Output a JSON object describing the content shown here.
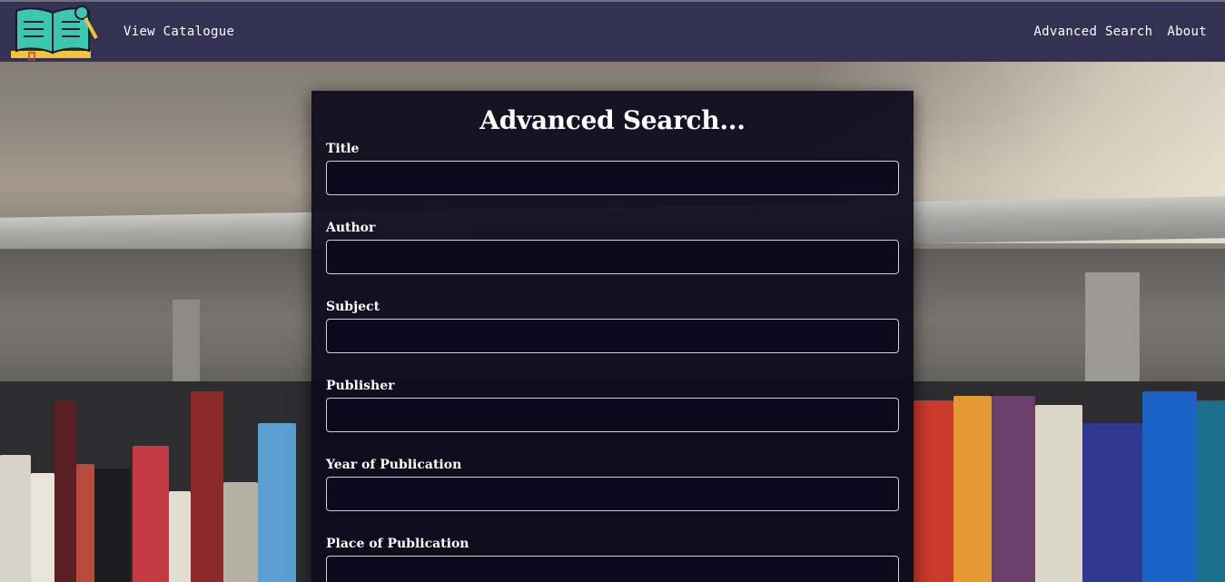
{
  "nav": {
    "logo_icon": "book-magnifier-logo",
    "view_catalogue": "View Catalogue",
    "advanced_search": "Advanced Search",
    "about": "About"
  },
  "form": {
    "heading": "Advanced Search...",
    "fields": [
      {
        "label": "Title",
        "value": "",
        "placeholder": ""
      },
      {
        "label": "Author",
        "value": "",
        "placeholder": ""
      },
      {
        "label": "Subject",
        "value": "",
        "placeholder": ""
      },
      {
        "label": "Publisher",
        "value": "",
        "placeholder": ""
      },
      {
        "label": "Year of Publication",
        "value": "",
        "placeholder": ""
      },
      {
        "label": "Place of Publication",
        "value": "",
        "placeholder": ""
      }
    ]
  },
  "colors": {
    "nav_bg": "#343152",
    "panel_bg": "#0c0a1c",
    "text": "#ffffff"
  }
}
